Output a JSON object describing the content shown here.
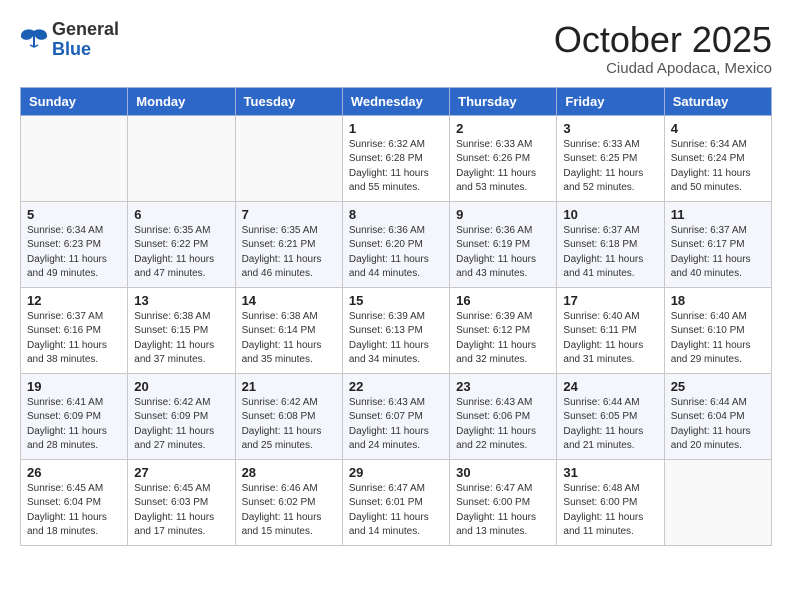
{
  "logo": {
    "general": "General",
    "blue": "Blue"
  },
  "header": {
    "month": "October 2025",
    "location": "Ciudad Apodaca, Mexico"
  },
  "weekdays": [
    "Sunday",
    "Monday",
    "Tuesday",
    "Wednesday",
    "Thursday",
    "Friday",
    "Saturday"
  ],
  "weeks": [
    [
      {
        "day": "",
        "sunrise": "",
        "sunset": "",
        "daylight": ""
      },
      {
        "day": "",
        "sunrise": "",
        "sunset": "",
        "daylight": ""
      },
      {
        "day": "",
        "sunrise": "",
        "sunset": "",
        "daylight": ""
      },
      {
        "day": "1",
        "sunrise": "Sunrise: 6:32 AM",
        "sunset": "Sunset: 6:28 PM",
        "daylight": "Daylight: 11 hours and 55 minutes."
      },
      {
        "day": "2",
        "sunrise": "Sunrise: 6:33 AM",
        "sunset": "Sunset: 6:26 PM",
        "daylight": "Daylight: 11 hours and 53 minutes."
      },
      {
        "day": "3",
        "sunrise": "Sunrise: 6:33 AM",
        "sunset": "Sunset: 6:25 PM",
        "daylight": "Daylight: 11 hours and 52 minutes."
      },
      {
        "day": "4",
        "sunrise": "Sunrise: 6:34 AM",
        "sunset": "Sunset: 6:24 PM",
        "daylight": "Daylight: 11 hours and 50 minutes."
      }
    ],
    [
      {
        "day": "5",
        "sunrise": "Sunrise: 6:34 AM",
        "sunset": "Sunset: 6:23 PM",
        "daylight": "Daylight: 11 hours and 49 minutes."
      },
      {
        "day": "6",
        "sunrise": "Sunrise: 6:35 AM",
        "sunset": "Sunset: 6:22 PM",
        "daylight": "Daylight: 11 hours and 47 minutes."
      },
      {
        "day": "7",
        "sunrise": "Sunrise: 6:35 AM",
        "sunset": "Sunset: 6:21 PM",
        "daylight": "Daylight: 11 hours and 46 minutes."
      },
      {
        "day": "8",
        "sunrise": "Sunrise: 6:36 AM",
        "sunset": "Sunset: 6:20 PM",
        "daylight": "Daylight: 11 hours and 44 minutes."
      },
      {
        "day": "9",
        "sunrise": "Sunrise: 6:36 AM",
        "sunset": "Sunset: 6:19 PM",
        "daylight": "Daylight: 11 hours and 43 minutes."
      },
      {
        "day": "10",
        "sunrise": "Sunrise: 6:37 AM",
        "sunset": "Sunset: 6:18 PM",
        "daylight": "Daylight: 11 hours and 41 minutes."
      },
      {
        "day": "11",
        "sunrise": "Sunrise: 6:37 AM",
        "sunset": "Sunset: 6:17 PM",
        "daylight": "Daylight: 11 hours and 40 minutes."
      }
    ],
    [
      {
        "day": "12",
        "sunrise": "Sunrise: 6:37 AM",
        "sunset": "Sunset: 6:16 PM",
        "daylight": "Daylight: 11 hours and 38 minutes."
      },
      {
        "day": "13",
        "sunrise": "Sunrise: 6:38 AM",
        "sunset": "Sunset: 6:15 PM",
        "daylight": "Daylight: 11 hours and 37 minutes."
      },
      {
        "day": "14",
        "sunrise": "Sunrise: 6:38 AM",
        "sunset": "Sunset: 6:14 PM",
        "daylight": "Daylight: 11 hours and 35 minutes."
      },
      {
        "day": "15",
        "sunrise": "Sunrise: 6:39 AM",
        "sunset": "Sunset: 6:13 PM",
        "daylight": "Daylight: 11 hours and 34 minutes."
      },
      {
        "day": "16",
        "sunrise": "Sunrise: 6:39 AM",
        "sunset": "Sunset: 6:12 PM",
        "daylight": "Daylight: 11 hours and 32 minutes."
      },
      {
        "day": "17",
        "sunrise": "Sunrise: 6:40 AM",
        "sunset": "Sunset: 6:11 PM",
        "daylight": "Daylight: 11 hours and 31 minutes."
      },
      {
        "day": "18",
        "sunrise": "Sunrise: 6:40 AM",
        "sunset": "Sunset: 6:10 PM",
        "daylight": "Daylight: 11 hours and 29 minutes."
      }
    ],
    [
      {
        "day": "19",
        "sunrise": "Sunrise: 6:41 AM",
        "sunset": "Sunset: 6:09 PM",
        "daylight": "Daylight: 11 hours and 28 minutes."
      },
      {
        "day": "20",
        "sunrise": "Sunrise: 6:42 AM",
        "sunset": "Sunset: 6:09 PM",
        "daylight": "Daylight: 11 hours and 27 minutes."
      },
      {
        "day": "21",
        "sunrise": "Sunrise: 6:42 AM",
        "sunset": "Sunset: 6:08 PM",
        "daylight": "Daylight: 11 hours and 25 minutes."
      },
      {
        "day": "22",
        "sunrise": "Sunrise: 6:43 AM",
        "sunset": "Sunset: 6:07 PM",
        "daylight": "Daylight: 11 hours and 24 minutes."
      },
      {
        "day": "23",
        "sunrise": "Sunrise: 6:43 AM",
        "sunset": "Sunset: 6:06 PM",
        "daylight": "Daylight: 11 hours and 22 minutes."
      },
      {
        "day": "24",
        "sunrise": "Sunrise: 6:44 AM",
        "sunset": "Sunset: 6:05 PM",
        "daylight": "Daylight: 11 hours and 21 minutes."
      },
      {
        "day": "25",
        "sunrise": "Sunrise: 6:44 AM",
        "sunset": "Sunset: 6:04 PM",
        "daylight": "Daylight: 11 hours and 20 minutes."
      }
    ],
    [
      {
        "day": "26",
        "sunrise": "Sunrise: 6:45 AM",
        "sunset": "Sunset: 6:04 PM",
        "daylight": "Daylight: 11 hours and 18 minutes."
      },
      {
        "day": "27",
        "sunrise": "Sunrise: 6:45 AM",
        "sunset": "Sunset: 6:03 PM",
        "daylight": "Daylight: 11 hours and 17 minutes."
      },
      {
        "day": "28",
        "sunrise": "Sunrise: 6:46 AM",
        "sunset": "Sunset: 6:02 PM",
        "daylight": "Daylight: 11 hours and 15 minutes."
      },
      {
        "day": "29",
        "sunrise": "Sunrise: 6:47 AM",
        "sunset": "Sunset: 6:01 PM",
        "daylight": "Daylight: 11 hours and 14 minutes."
      },
      {
        "day": "30",
        "sunrise": "Sunrise: 6:47 AM",
        "sunset": "Sunset: 6:00 PM",
        "daylight": "Daylight: 11 hours and 13 minutes."
      },
      {
        "day": "31",
        "sunrise": "Sunrise: 6:48 AM",
        "sunset": "Sunset: 6:00 PM",
        "daylight": "Daylight: 11 hours and 11 minutes."
      },
      {
        "day": "",
        "sunrise": "",
        "sunset": "",
        "daylight": ""
      }
    ]
  ]
}
